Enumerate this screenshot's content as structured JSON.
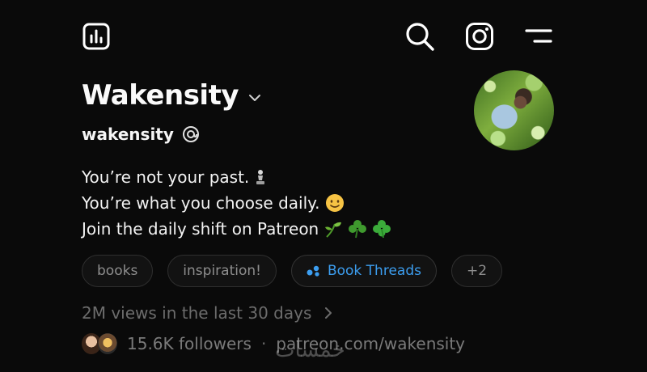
{
  "profile": {
    "display_name": "Wakensity",
    "username": "wakensity"
  },
  "bio": {
    "line1": "You’re not your past.",
    "line2": "You’re what you choose daily.",
    "line3": "Join the daily shift on Patreon"
  },
  "chips": [
    {
      "label": "books"
    },
    {
      "label": "inspiration!"
    },
    {
      "label": "Book Threads"
    },
    {
      "label": "+2"
    }
  ],
  "insights": {
    "views_text": "2M views in the last 30 days"
  },
  "followers": {
    "count_text": "15.6K followers",
    "separator": "·",
    "link": "patreon.com/wakensity"
  },
  "watermark": {
    "text": "خمسات"
  },
  "colors": {
    "background": "#0a0a0a",
    "accent_blue": "#3c9ef0",
    "muted_text": "#7a7a7a"
  },
  "icons": [
    "insights-icon",
    "search-icon",
    "instagram-icon",
    "menu-icon",
    "chevron-down-icon",
    "threads-logo-icon",
    "chevron-right-icon"
  ]
}
